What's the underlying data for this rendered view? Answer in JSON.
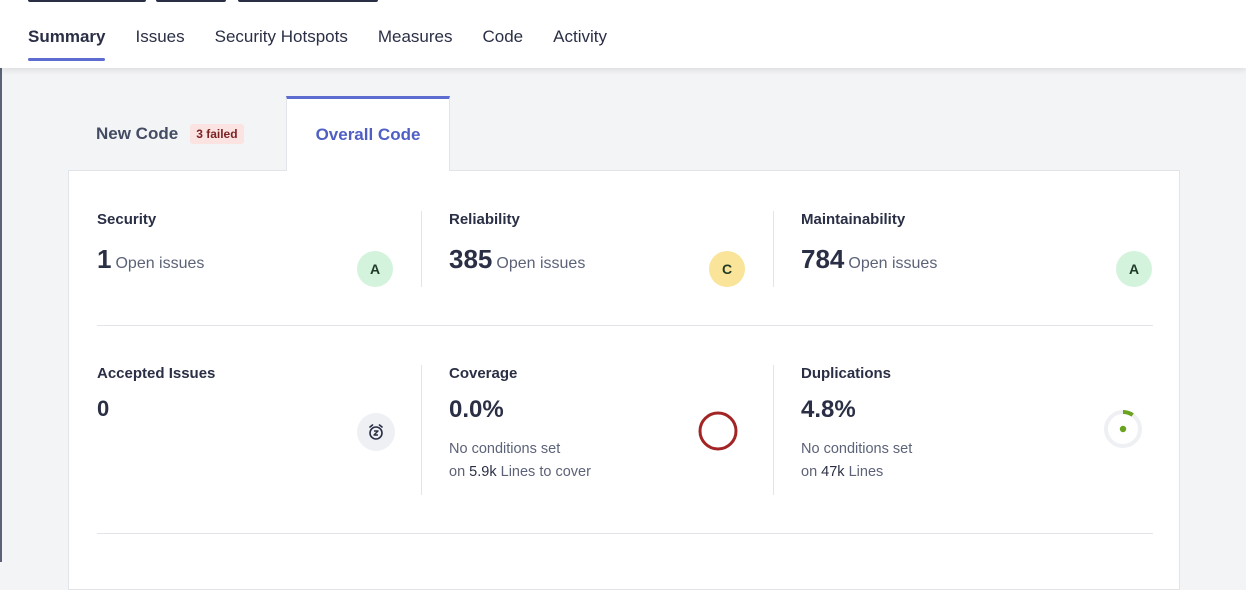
{
  "nav": {
    "items": [
      {
        "label": "Summary",
        "active": true
      },
      {
        "label": "Issues"
      },
      {
        "label": "Security Hotspots"
      },
      {
        "label": "Measures"
      },
      {
        "label": "Code"
      },
      {
        "label": "Activity"
      }
    ]
  },
  "tabs": {
    "new_code": {
      "label": "New Code",
      "badge": "3 failed"
    },
    "overall_code": {
      "label": "Overall Code"
    }
  },
  "metrics": {
    "security": {
      "title": "Security",
      "value": "1",
      "suffix": "Open issues",
      "grade": "A",
      "grade_color": "#d3f3dd"
    },
    "reliability": {
      "title": "Reliability",
      "value": "385",
      "suffix": "Open issues",
      "grade": "C",
      "grade_color": "#f9e49a"
    },
    "maintainability": {
      "title": "Maintainability",
      "value": "784",
      "suffix": "Open issues",
      "grade": "A",
      "grade_color": "#d3f3dd"
    },
    "accepted": {
      "title": "Accepted Issues",
      "value": "0",
      "icon": "snooze-clock-icon"
    },
    "coverage": {
      "title": "Coverage",
      "value": "0.0%",
      "line1": "No conditions set",
      "line2_prefix": "on",
      "line2_value": "5.9k",
      "line2_suffix": "Lines to cover",
      "indicator_color": "#a32424",
      "coverage_fraction": 0.0
    },
    "duplications": {
      "title": "Duplications",
      "value": "4.8%",
      "line1": "No conditions set",
      "line2_prefix": "on",
      "line2_value": "47k",
      "line2_suffix": "Lines",
      "indicator_color": "#6aa320",
      "duplication_fraction": 0.048
    }
  }
}
